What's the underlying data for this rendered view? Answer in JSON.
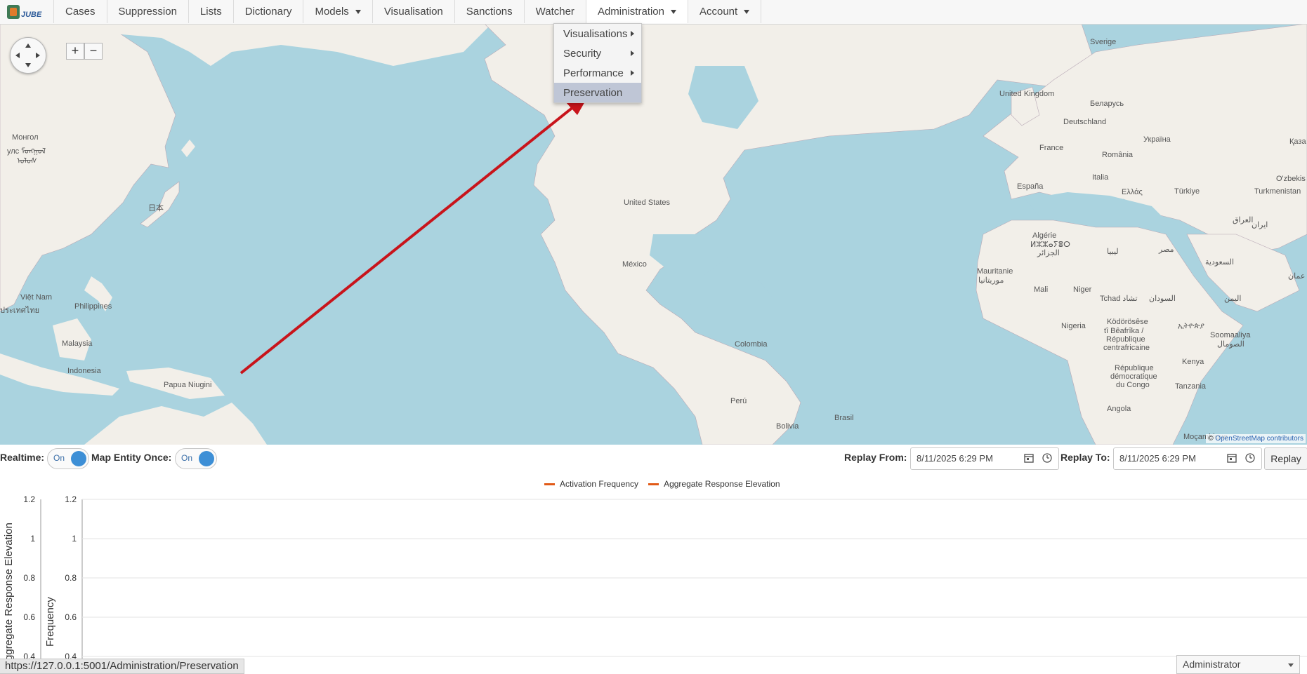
{
  "nav": {
    "items": [
      {
        "label": "Cases"
      },
      {
        "label": "Suppression"
      },
      {
        "label": "Lists"
      },
      {
        "label": "Dictionary"
      },
      {
        "label": "Models"
      },
      {
        "label": "Visualisation"
      },
      {
        "label": "Sanctions"
      },
      {
        "label": "Watcher"
      },
      {
        "label": "Administration"
      },
      {
        "label": "Account"
      }
    ],
    "logo_text": "JUBE"
  },
  "admin_menu": {
    "items": [
      {
        "label": "Visualisations"
      },
      {
        "label": "Security"
      },
      {
        "label": "Performance"
      },
      {
        "label": "Preservation"
      }
    ]
  },
  "map": {
    "labels": [
      "Sverige",
      "United Kingdom",
      "Беларусь",
      "Deutschland",
      "Україна",
      "France",
      "România",
      "Қаза",
      "Italia",
      "España",
      "Ελλάς",
      "Türkiye",
      "O'zbekis",
      "Turkmenistan",
      "Algérie",
      "ⵍⵣⵣⴰⵢⴻⵔ",
      "الجزائر",
      "ليبيا",
      "مصر",
      "العراق",
      "ایران",
      "السعودية",
      "Mauritanie",
      "موريتانيا",
      "Mali",
      "Niger",
      "Tchad تشاد",
      "السودان",
      "اليمن",
      "عمان",
      "Nigeria",
      "Ködörösêse",
      "tî Bêafrîka /",
      "République",
      "centrafricaine",
      "ኢትዮጵያ",
      "Soomaaliya",
      "الصومال",
      "République",
      "démocratique",
      "du Congo",
      "Kenya",
      "Tanzania",
      "Angola",
      "Moçambique",
      "United States",
      "México",
      "Colombia",
      "Perú",
      "Bolivia",
      "Brasil",
      "Монгол",
      "улс ᠮᠣᠩᠭᠣᠯ",
      "ᠤᠯᠤᠰ",
      "日本",
      "Việt Nam",
      "Philippines",
      "ประเทศไทย",
      "Malaysia",
      "Indonesia",
      "Papua Niugini"
    ],
    "attribution_prefix": "©",
    "attribution_link": "OpenStreetMap contributors"
  },
  "controls": {
    "realtime_label": "Realtime:",
    "realtime_toggle": "On",
    "map_entity_label": "Map Entity Once:",
    "map_entity_toggle": "On",
    "replay_from_label": "Replay From:",
    "replay_from_value": "8/11/2025 6:29 PM",
    "replay_to_label": "Replay To:",
    "replay_to_value": "8/11/2025 6:29 PM",
    "replay_button": "Replay"
  },
  "chart_data": {
    "type": "line",
    "series": [
      {
        "name": "Activation Frequency",
        "values": []
      },
      {
        "name": "Aggregate Response Elevation",
        "values": []
      }
    ],
    "y_axes": [
      {
        "label": "Aggregate Response Elevation",
        "ticks": [
          "1.2",
          "1",
          "0.8",
          "0.6",
          "0.4"
        ]
      },
      {
        "label": "Frequency",
        "ticks": [
          "1.2",
          "1",
          "0.8",
          "0.6",
          "0.4"
        ]
      }
    ],
    "series_color": "#e15a17"
  },
  "status": {
    "url": "https://127.0.0.1:5001/Administration/Preservation",
    "user": "Administrator"
  }
}
